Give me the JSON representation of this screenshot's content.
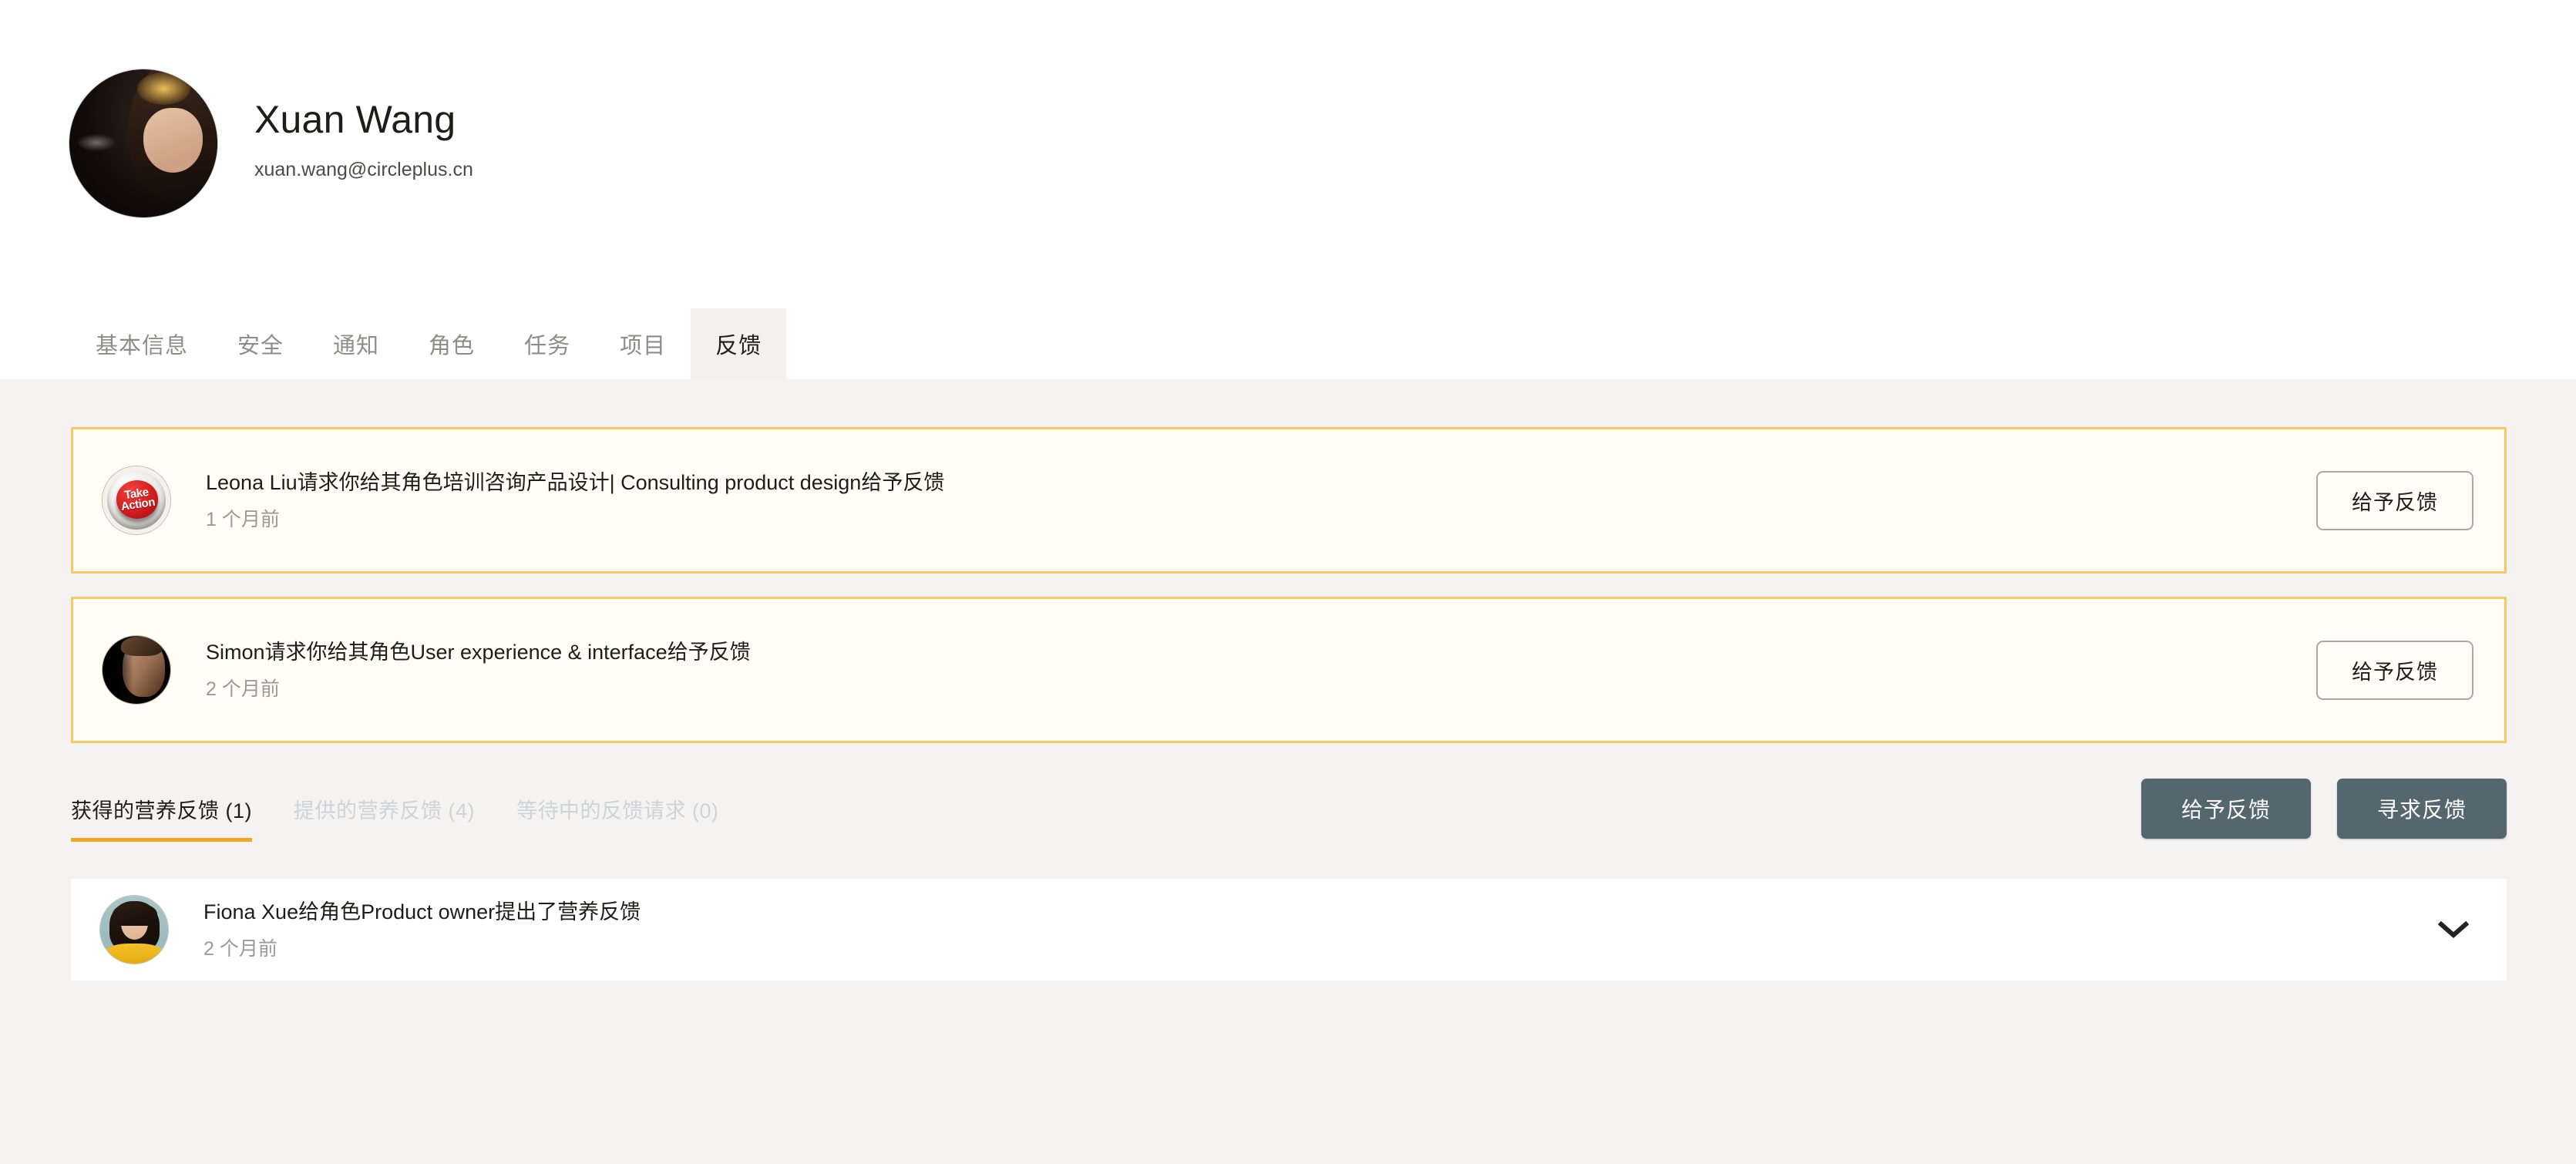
{
  "profile": {
    "name": "Xuan Wang",
    "email": "xuan.wang@circleplus.cn",
    "avatar_icon": "user-avatar-photo"
  },
  "tabs": [
    {
      "label": "基本信息",
      "active": false
    },
    {
      "label": "安全",
      "active": false
    },
    {
      "label": "通知",
      "active": false
    },
    {
      "label": "角色",
      "active": false
    },
    {
      "label": "任务",
      "active": false
    },
    {
      "label": "项目",
      "active": false
    },
    {
      "label": "反馈",
      "active": true
    }
  ],
  "requests": [
    {
      "title": "Leona Liu请求你给其角色培训咨询产品设计| Consulting product design给予反馈",
      "time": "1 个月前",
      "button_label": "给予反馈",
      "avatar_icon": "take-action-button-avatar"
    },
    {
      "title": "Simon请求你给其角色User experience & interface给予反馈",
      "time": "2 个月前",
      "button_label": "给予反馈",
      "avatar_icon": "simon-avatar-photo"
    }
  ],
  "filters": [
    {
      "label": "获得的营养反馈",
      "count": "(1)",
      "active": true
    },
    {
      "label": "提供的营养反馈",
      "count": "(4)",
      "active": false
    },
    {
      "label": "等待中的反馈请求",
      "count": "(0)",
      "active": false
    }
  ],
  "actions": {
    "give_feedback": "给予反馈",
    "request_feedback": "寻求反馈"
  },
  "feedback_items": [
    {
      "title": "Fiona Xue给角色Product owner提出了营养反馈",
      "time": "2 个月前",
      "avatar_icon": "fiona-xue-avatar-photo",
      "expand_icon": "chevron-down-icon"
    }
  ],
  "colors": {
    "accent_orange": "#f5a623",
    "card_border": "#fac863",
    "card_bg": "#fffdf4",
    "button_solid": "#54676f",
    "page_bg": "#f4f3f1",
    "muted_text": "#9a9a98",
    "inactive_filter": "#cdd4d8"
  }
}
